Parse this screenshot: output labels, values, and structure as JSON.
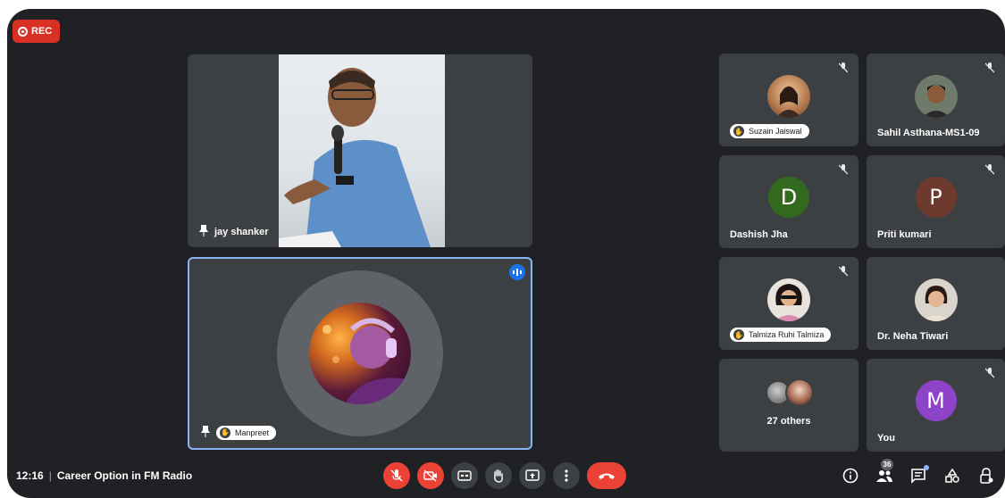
{
  "recording": {
    "label": "REC"
  },
  "main_tiles": [
    {
      "name": "jay shanker"
    },
    {
      "name": "Manpreet"
    }
  ],
  "grid_tiles": [
    {
      "name": "Suzain Jaiswal",
      "type": "photo"
    },
    {
      "name": "Sahil Asthana-MS1-09",
      "type": "photo"
    },
    {
      "name": "Dashish Jha",
      "type": "letter",
      "letter": "D",
      "color": "#33691e"
    },
    {
      "name": "Priti kumari",
      "type": "letter",
      "letter": "P",
      "color": "#6d3a2d"
    },
    {
      "name": "Talmiza Ruhi Talmiza",
      "type": "photo"
    },
    {
      "name": "Dr. Neha Tiwari",
      "type": "photo"
    },
    {
      "name": "27 others",
      "type": "group"
    },
    {
      "name": "You",
      "type": "letter",
      "letter": "M",
      "color": "#8e44c9"
    }
  ],
  "bottom_bar": {
    "time": "12:16",
    "separator": "|",
    "meeting_title": "Career Option in FM Radio",
    "participant_count": "36"
  },
  "colors": {
    "background": "#202124",
    "tile": "#3c4043",
    "danger": "#ea4335",
    "speaking_border": "#8ab4f8"
  }
}
